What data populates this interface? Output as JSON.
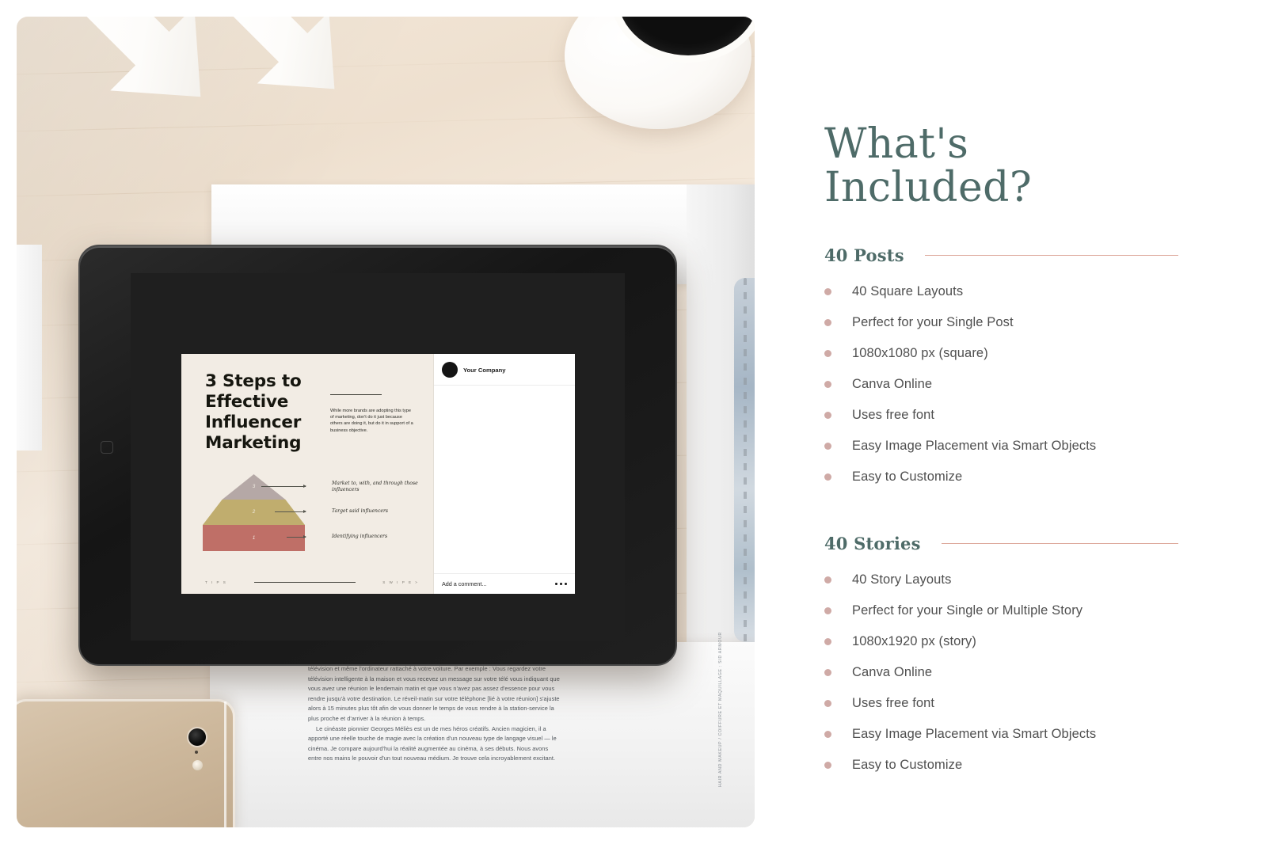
{
  "panel": {
    "title": "What's Included?",
    "sections": [
      {
        "heading": "40 Posts",
        "items": [
          "40 Square Layouts",
          "Perfect for your Single Post",
          "1080x1080 px (square)",
          "Canva Online",
          "Uses free font",
          "Easy Image Placement via Smart Objects",
          "Easy to Customize"
        ]
      },
      {
        "heading": "40 Stories",
        "items": [
          "40 Story Layouts",
          "Perfect for your Single or Multiple Story",
          "1080x1920 px (story)",
          "Canva Online",
          "Uses free font",
          "Easy Image Placement via Smart Objects",
          "Easy to Customize"
        ]
      }
    ]
  },
  "colors": {
    "heading_teal": "#4e6b68",
    "rule_rose": "#dda79a",
    "bullet_rose": "#cfaaa6",
    "body_gray": "#4f4f4f",
    "slide_bg": "#f2ece4",
    "pyramid_top": "#b5a8a6",
    "pyramid_mid": "#c0ad6e",
    "pyramid_bottom": "#bf6f67"
  },
  "slide": {
    "title": "3 Steps to Effective Influencer Marketing",
    "body": "While more brands are adopting this type of marketing, don't do it just because others are doing it, but do it in support of a business objective.",
    "pyramid": [
      {
        "number": "3",
        "label": "Market to, with, and through those influencers"
      },
      {
        "number": "2",
        "label": "Target said influencers"
      },
      {
        "number": "1",
        "label": "Identifying influencers"
      }
    ],
    "footer_left": "T I P S",
    "footer_right": "S W I P E  >"
  },
  "post": {
    "company": "Your Company",
    "comment_placeholder": "Add a comment..."
  },
  "magazine": {
    "paragraph_1": "télévision et même l'ordinateur rattaché à votre voiture. Par exemple : Vous regardez votre télévision intelligente à la maison et vous recevez un message sur votre télé vous indiquant que vous avez une réunion le lendemain matin et que vous n'avez pas assez d'essence pour vous rendre jusqu'à votre destination. Le réveil-matin sur votre téléphone [lié à votre réunion] s'ajuste alors à 15 minutes plus tôt afin de vous donner le temps de vous rendre à la station-service la plus proche et d'arriver à la réunion à temps.",
    "paragraph_2": "Le cinéaste pionnier Georges Méliès est un de mes héros créatifs. Ancien magicien, il a apporté une réelle touche de magie avec la création d'un nouveau type de langage visuel — le cinéma. Je compare aujourd'hui la réalité augmentée au cinéma, à ses débuts. Nous avons entre nos mains le pouvoir d'un tout nouveau médium. Je trouve cela incroyablement excitant.",
    "side_credit": "HAIR AND MAKEUP / COIFFURE ET MAQUILLAGE : SID ARMOUR"
  }
}
